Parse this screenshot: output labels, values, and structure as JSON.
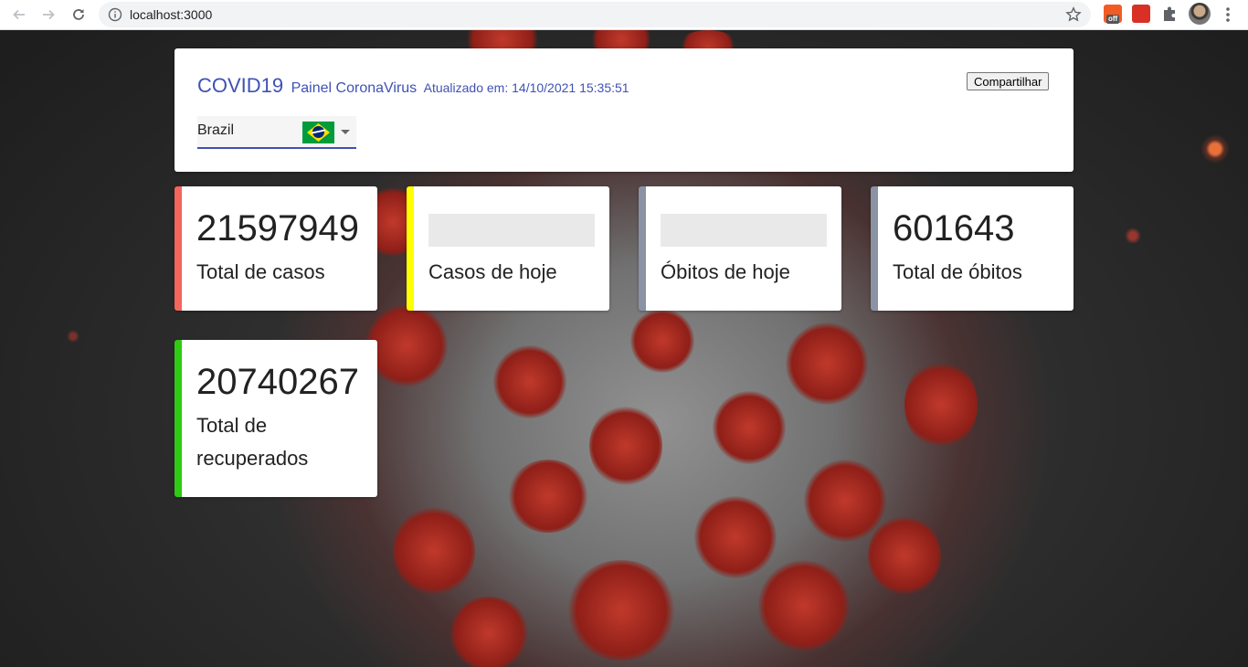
{
  "browser": {
    "url": "localhost:3000",
    "extensions": [
      {
        "name": "extension-off",
        "badge": "off",
        "color": "#f25c24"
      },
      {
        "name": "extension-red",
        "color": "#d93025"
      }
    ]
  },
  "header": {
    "title": "COVID19",
    "subtitle": "Painel CoronaVirus",
    "updated": "Atualizado em: 14/10/2021 15:35:51",
    "share_label": "Compartilhar",
    "accent_color": "#3f51b5"
  },
  "country_select": {
    "selected": "Brazil",
    "flag_icon": "brazil-flag-icon"
  },
  "cards": [
    {
      "value": "21597949",
      "label": "Total de casos",
      "color": "#f4665c"
    },
    {
      "value": "",
      "label": "Casos de hoje",
      "color": "#ffff00",
      "loading": true
    },
    {
      "value": "",
      "label": "Óbitos de hoje",
      "color": "#8a93a3",
      "loading": true
    },
    {
      "value": "601643",
      "label": "Total de óbitos",
      "color": "#8a93a3"
    },
    {
      "value": "20740267",
      "label_line1": "Total de",
      "label_line2": "recuperados",
      "color": "#2fcb14"
    }
  ]
}
